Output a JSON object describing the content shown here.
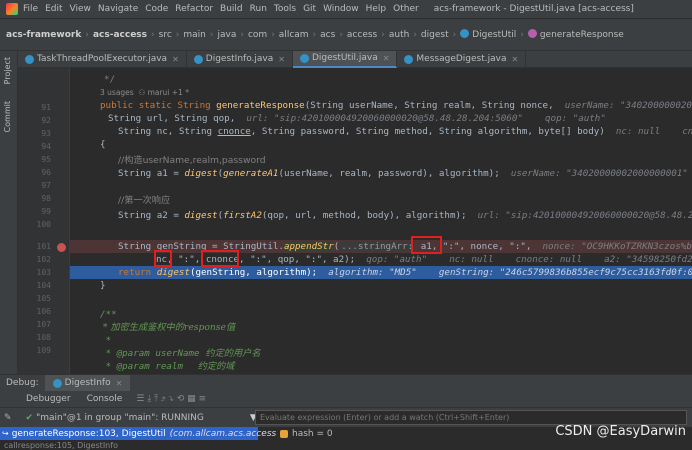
{
  "titlebar": {
    "menu": [
      "File",
      "Edit",
      "View",
      "Navigate",
      "Code",
      "Refactor",
      "Build",
      "Run",
      "Tools",
      "Git",
      "Window",
      "Help",
      "Other"
    ],
    "window_title": "acs-framework - DigestUtil.java [acs-access]"
  },
  "breadcrumb": [
    "acs-framework",
    "acs-access",
    "src",
    "main",
    "java",
    "com",
    "allcam",
    "acs",
    "access",
    "auth",
    "digest",
    "DigestUtil",
    "generateResponse"
  ],
  "tabs": [
    {
      "label": "TaskThreadPoolExecutor.java",
      "active": false
    },
    {
      "label": "DigestInfo.java",
      "active": false
    },
    {
      "label": "DigestUtil.java",
      "active": true
    },
    {
      "label": "MessageDigest.java",
      "active": false
    }
  ],
  "side_tabs": {
    "project": "Project",
    "commit": "Commit"
  },
  "line_numbers": [
    "",
    "",
    "91",
    "92",
    "93",
    "94",
    "95",
    "96",
    "97",
    "98",
    "99",
    "100",
    "",
    "101",
    "102",
    "103",
    "104",
    "105",
    "106",
    "107",
    "108",
    "109"
  ],
  "code": {
    "l_close": "*/",
    "usages": "3 usages  ⚇ marui +1 *",
    "l91_a": "public static String ",
    "l91_fn": "generateResponse",
    "l91_b": "(String userName, String realm, String nonce,",
    "l91_hint": "userName: \"34020000002000000001\"",
    "l92_a": "String url, String qop,",
    "l92_hint": "url: \"sip:420100004920060000020@58.48.28.204:5060\"    qop: \"auth\"",
    "l93_a": "String nc, String ",
    "l93_u": "cnonce",
    "l93_b": ", String password, String method, String algorithm, byte[] body)",
    "l93_hint": "nc: null    cnonce: null",
    "l94": "{",
    "l95": "//构造userName,realm,password",
    "l96_a": "String a1 = ",
    "l96_fn": "digest",
    "l96_b": "(",
    "l96_fn2": "generateA1",
    "l96_c": "(userName, realm, password), algorithm);",
    "l96_hint": "userName: \"34020000002000000001\"    realm:",
    "l98": "//第一次响应",
    "l99_a": "String a2 = ",
    "l99_fn": "digest",
    "l99_b": "(",
    "l99_fn2": "firstA2",
    "l99_c": "(qop, url, method, body), algorithm);",
    "l99_hint": "url: \"sip:420100004920060000020@58.48.28.204:5060",
    "l101_a": "String genString = StringUtil.",
    "l101_fn": "appendStr",
    "l101_b": "(",
    "l101_pm": "...stringArr:",
    "l101_c": " a1, \":\", ",
    "l101_nonce": "nonce",
    "l101_d": ", \":\",",
    "l101_hint": "nonce: \"OC9HKKoTZRKN3czos%bGkuU81U6sb1bGo",
    "l102_nc": "nc",
    "l102_a": ", \":\", ",
    "l102_cnonce": "cnonce",
    "l102_b": ", \":\", qop, \":\", a2);",
    "l102_hint": "qop: \"auth\"    nc: null    cnonce: null    a2: \"34598250fd2fd2f890af",
    "l103_a": "return ",
    "l103_fn": "digest",
    "l103_b": "(genString, algorithm);",
    "l103_hint": "algorithm: \"MD5\"    genString: \"246c5799836b855ecf9c75cc3163fd0f:0C9HKkoTZRK",
    "l104": "}",
    "l106": "/**",
    "l107": " * 加密生成鉴权中的response值",
    "l108": " *",
    "l109_a": " * @param userName",
    "l109_b": "  约定的用户名",
    "l110_a": " * @param realm",
    "l110_b": "     约定的域"
  },
  "debug": {
    "label": "Debug:",
    "config": "DigestInfo",
    "tabs": [
      "Debugger",
      "Console"
    ],
    "thread": "\"main\"@1 in group \"main\": RUNNING",
    "eval_placeholder": "Evaluate expression (Enter) or add a watch (Ctrl+Shift+Enter)",
    "frame": "generateResponse:103, DigestUtil",
    "frame_pkg": "(com.allcam.acs.access",
    "var": "hash = 0",
    "next_frame": "callresponse:105, DigestInfo"
  },
  "watermark": "CSDN @EasyDarwin",
  "colors": {
    "keyword": "#cc7832",
    "method": "#ffc66d",
    "string": "#6a8759",
    "comment": "#808080",
    "breakpoint_line": "#4e3535",
    "exec_line": "#2d5d9f",
    "highlight_box": "#e02020"
  }
}
